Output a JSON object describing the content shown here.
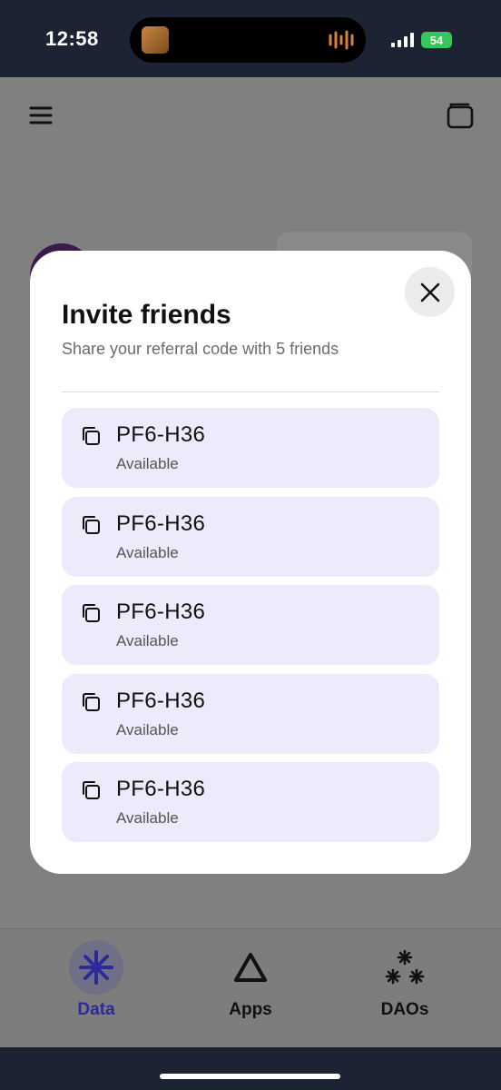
{
  "status_bar": {
    "time": "12:58",
    "battery": "54"
  },
  "bottom_nav": {
    "items": [
      {
        "label": "Data",
        "icon": "asterisk-icon",
        "active": true
      },
      {
        "label": "Apps",
        "icon": "triangle-icon",
        "active": false
      },
      {
        "label": "DAOs",
        "icon": "stars-icon",
        "active": false
      }
    ]
  },
  "modal": {
    "title": "Invite friends",
    "subtitle": "Share your referral code with 5 friends",
    "codes": [
      {
        "code": "PF6-H36",
        "status": "Available"
      },
      {
        "code": "PF6-H36",
        "status": "Available"
      },
      {
        "code": "PF6-H36",
        "status": "Available"
      },
      {
        "code": "PF6-H36",
        "status": "Available"
      },
      {
        "code": "PF6-H36",
        "status": "Available"
      }
    ]
  },
  "colors": {
    "accent": "#2a2a9a",
    "code_bg": "#ebebfb",
    "status_bar_bg": "#1c2433"
  }
}
